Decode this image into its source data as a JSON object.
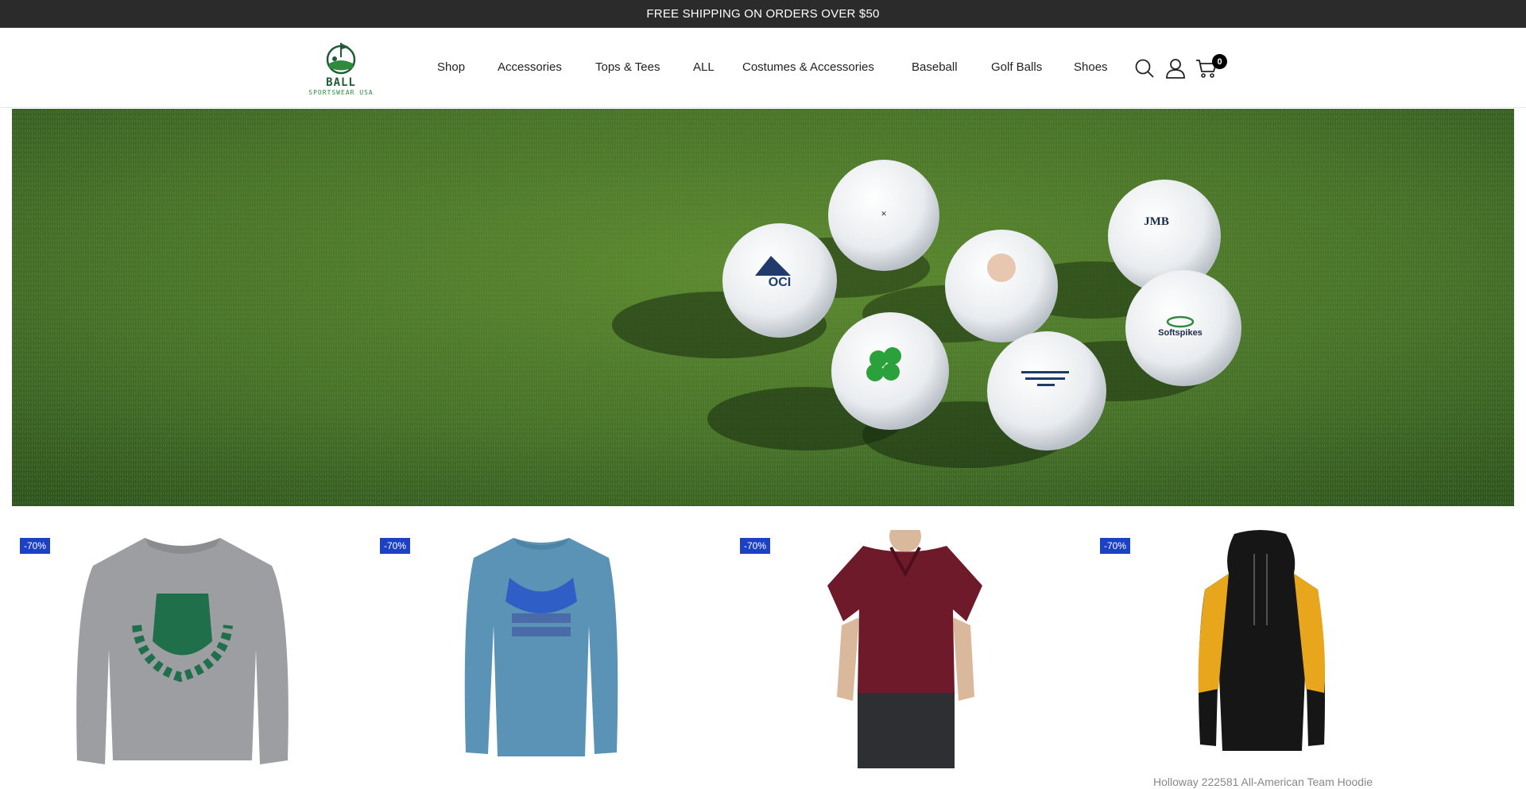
{
  "announcement": "FREE SHIPPING ON ORDERS OVER $50",
  "logo": {
    "name": "BALL",
    "tagline": "SPORTSWEAR USA"
  },
  "nav": {
    "items": [
      "Shop",
      "Accessories",
      "Tops & Tees",
      "ALL",
      "Costumes & Accessories",
      "Baseball",
      "Golf Balls",
      "Shoes"
    ]
  },
  "header_icons": {
    "search": "search-icon",
    "account": "user-icon",
    "cart": "cart-icon"
  },
  "cart": {
    "count": "0"
  },
  "hero": {
    "ball_prints": {
      "top_right": "JMB",
      "right": "Softspikes",
      "left": "OCI"
    }
  },
  "products": [
    {
      "discount": "-70%",
      "title": ""
    },
    {
      "discount": "-70%",
      "title": ""
    },
    {
      "discount": "-70%",
      "title": ""
    },
    {
      "discount": "-70%",
      "title": "Holloway 222581 All-American Team Hoodie"
    }
  ],
  "colors": {
    "announcement_bg": "#2b2b2b",
    "badge_bg": "#1d41c4",
    "brand_green": "#1e5c37",
    "grass": "#4f7a2a"
  }
}
